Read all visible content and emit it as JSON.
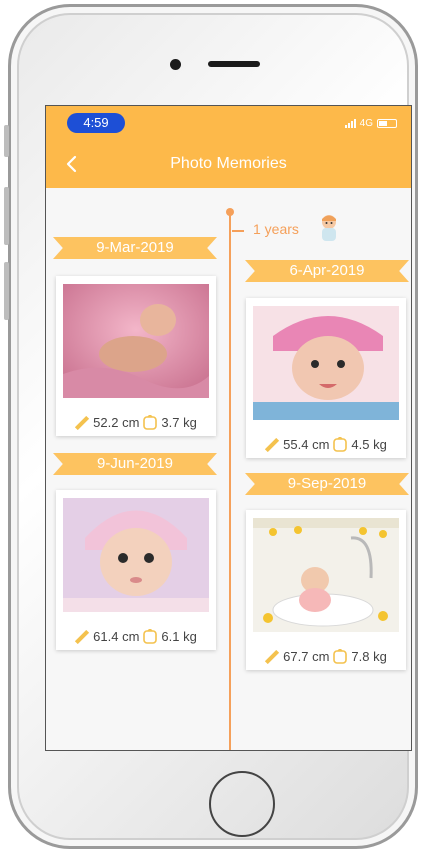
{
  "status": {
    "time": "4:59",
    "network": "4G"
  },
  "nav": {
    "title": "Photo Memories"
  },
  "timeline": {
    "year_label": "1 years"
  },
  "entries": [
    {
      "date": "9-Mar-2019",
      "height": "52.2 cm",
      "weight": "3.7 kg"
    },
    {
      "date": "6-Apr-2019",
      "height": "55.4 cm",
      "weight": "4.5 kg"
    },
    {
      "date": "9-Jun-2019",
      "height": "61.4 cm",
      "weight": "6.1 kg"
    },
    {
      "date": "9-Sep-2019",
      "height": "67.7 cm",
      "weight": "7.8 kg"
    }
  ],
  "colors": {
    "accent": "#fdb94a",
    "ribbon": "#fdc360",
    "timeline": "#f5a05a",
    "time_pill": "#1d4fd6"
  },
  "icons": [
    "back-chevron-icon",
    "ruler-icon",
    "scale-icon",
    "baby-icon",
    "signal-icon",
    "battery-icon"
  ]
}
